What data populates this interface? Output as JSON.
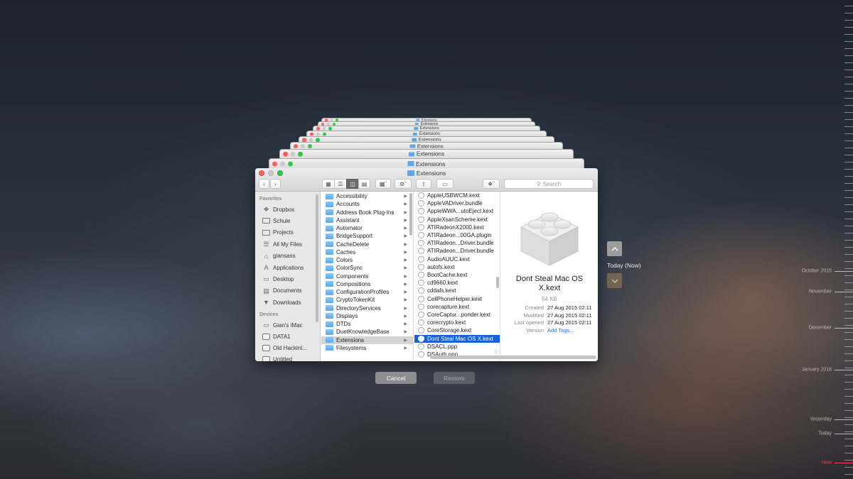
{
  "window": {
    "title": "Extensions",
    "stack_title": "Extensions",
    "search_placeholder": "Search",
    "icons": {
      "back": "chevron-left-icon",
      "forward": "chevron-right-icon",
      "action": "gear-icon",
      "share": "share-icon",
      "tags": "tag-icon",
      "dropbox": "dropbox-icon"
    }
  },
  "sidebar": {
    "favorites_header": "Favorites",
    "favorites": [
      {
        "label": "Dropbox",
        "icon": "dropbox-icon"
      },
      {
        "label": "Schule",
        "icon": "folder-icon"
      },
      {
        "label": "Projects",
        "icon": "folder-icon"
      },
      {
        "label": "All My Files",
        "icon": "all-files-icon"
      },
      {
        "label": "giansass",
        "icon": "home-icon"
      },
      {
        "label": "Applications",
        "icon": "applications-icon"
      },
      {
        "label": "Desktop",
        "icon": "desktop-icon"
      },
      {
        "label": "Documents",
        "icon": "documents-icon"
      },
      {
        "label": "Downloads",
        "icon": "downloads-icon"
      }
    ],
    "devices_header": "Devices",
    "devices": [
      {
        "label": "Gian's iMac",
        "icon": "imac-icon"
      },
      {
        "label": "DATA1",
        "icon": "disk-icon"
      },
      {
        "label": "Old Hackint...",
        "icon": "disk-icon"
      },
      {
        "label": "Untitled",
        "icon": "disk-icon"
      }
    ]
  },
  "column1": {
    "items": [
      "Accessibility",
      "Accounts",
      "Address Book Plug-Ins",
      "Assistant",
      "Automator",
      "BridgeSupport",
      "CacheDelete",
      "Caches",
      "Colors",
      "ColorSync",
      "Components",
      "Compositions",
      "ConfigurationProfiles",
      "CryptoTokenKit",
      "DirectoryServices",
      "Displays",
      "DTDs",
      "DuetKnowledgeBase",
      "Extensions",
      "Filesystems"
    ],
    "selected": "Extensions"
  },
  "column2": {
    "items": [
      "AppleUSBWCM.kext",
      "AppleVADriver.bundle",
      "AppleWWA...utoEject.kext",
      "AppleXsanScheme.kext",
      "ATIRadeonX2000.kext",
      "ATIRadeon...00GA.plugin",
      "ATIRadeon...Driver.bundle",
      "ATIRadeon...Driver.bundle",
      "AudioAUUC.kext",
      "autofs.kext",
      "BootCache.kext",
      "cd9660.kext",
      "cddafs.kext",
      "CellPhoneHelper.kext",
      "corecapture.kext",
      "CoreCaptur...ponder.kext",
      "corecrypto.kext",
      "CoreStorage.kext",
      "Dont Steal Mac OS X.kext",
      "DSACL.ppp",
      "DSAuth.ppp"
    ],
    "selected": "Dont Steal Mac OS X.kext"
  },
  "preview": {
    "name": "Dont Steal Mac OS X.kext",
    "size": "54 KB",
    "rows": [
      {
        "key": "Created",
        "value": "27 Aug 2015 02:11"
      },
      {
        "key": "Modified",
        "value": "27 Aug 2015 02:11"
      },
      {
        "key": "Last opened",
        "value": "27 Aug 2015 02:11"
      },
      {
        "key": "Version",
        "value": "Add Tags..."
      }
    ]
  },
  "time_machine": {
    "current_label": "Today (Now)",
    "cancel_label": "Cancel",
    "restore_label": "Restore",
    "timeline": [
      "October 2015",
      "November",
      "December",
      "January 2016",
      "Yesterday",
      "Today",
      "Now"
    ],
    "now_color": "#e9463f"
  },
  "colors": {
    "selection": "#1463d8",
    "folder": "#5fa8e8",
    "close": "#fc605c",
    "zoom": "#34c84a"
  }
}
